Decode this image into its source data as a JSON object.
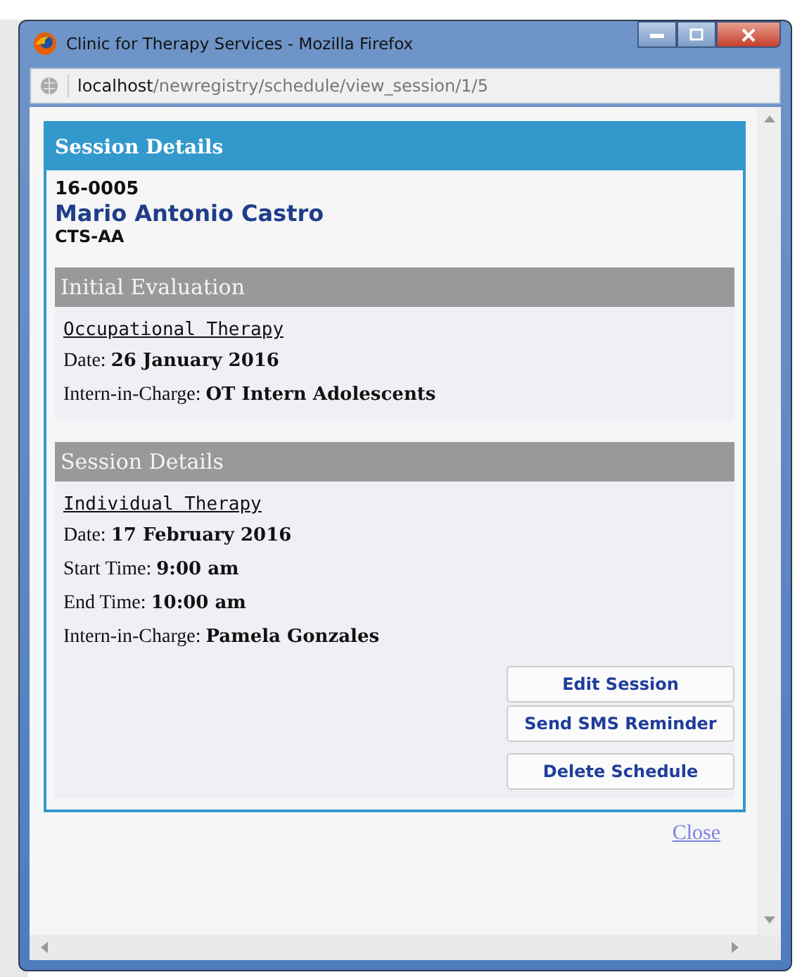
{
  "window": {
    "title": "Clinic for Therapy Services - Mozilla Firefox"
  },
  "address_bar": {
    "host": "localhost",
    "path": "/newregistry/schedule/view_session/1/5"
  },
  "dialog": {
    "title": "Session Details",
    "patient_id": "16-0005",
    "patient_name": "Mario Antonio Castro",
    "program": "CTS-AA",
    "sections": [
      {
        "title": "Initial Evaluation",
        "therapy": "Occupational Therapy",
        "fields": [
          {
            "label": "Date:",
            "value": "26 January 2016"
          },
          {
            "label": "Intern-in-Charge:",
            "value": "OT Intern Adolescents"
          }
        ]
      },
      {
        "title": "Session Details",
        "therapy": "Individual Therapy",
        "fields": [
          {
            "label": "Date:",
            "value": "17 February 2016"
          },
          {
            "label": "Start Time:",
            "value": "9:00 am"
          },
          {
            "label": "End Time:",
            "value": "10:00 am"
          },
          {
            "label": "Intern-in-Charge:",
            "value": "Pamela Gonzales"
          }
        ]
      }
    ],
    "buttons": [
      "Edit Session",
      "Send SMS Reminder",
      "Delete Schedule"
    ]
  },
  "close_link": "Close"
}
